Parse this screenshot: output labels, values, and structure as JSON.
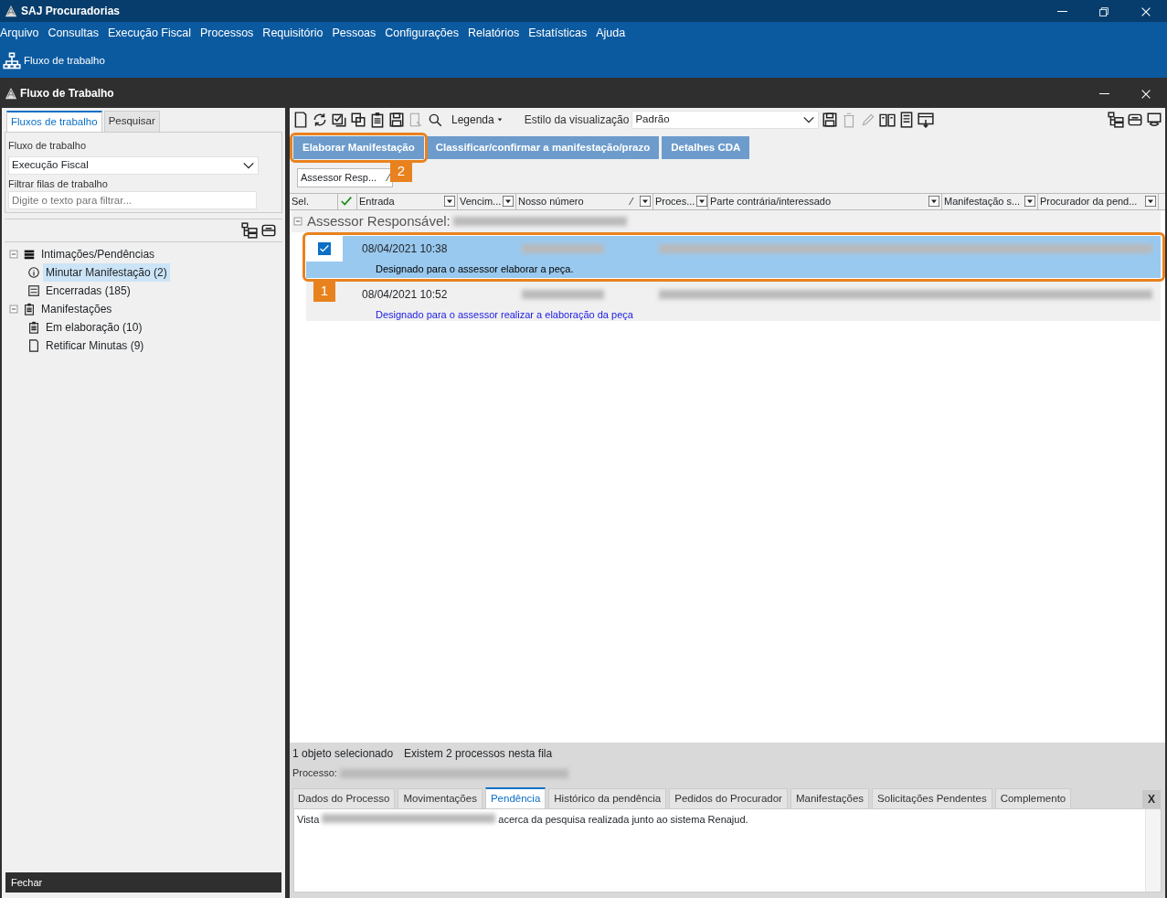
{
  "window": {
    "title": "SAJ Procuradorias"
  },
  "menu": [
    "Arquivo",
    "Consultas",
    "Execução Fiscal",
    "Processos",
    "Requisitório",
    "Pessoas",
    "Configurações",
    "Relatórios",
    "Estatísticas",
    "Ajuda"
  ],
  "ribbon": [
    {
      "label": "Fluxo de trabalho"
    }
  ],
  "inner_window": {
    "title": "Fluxo de Trabalho"
  },
  "sidebar": {
    "tabs": [
      {
        "label": "Fluxos de trabalho",
        "selected": true
      },
      {
        "label": "Pesquisar",
        "selected": false
      }
    ],
    "workflow_label": "Fluxo de trabalho",
    "workflow_value": "Execução Fiscal",
    "filter_label": "Filtrar filas de trabalho",
    "filter_placeholder": "Digite o texto para filtrar...",
    "tree": [
      {
        "label": "Intimações/Pendências",
        "kind": "list",
        "expanded": true,
        "selected": false,
        "children": [
          {
            "label": "Minutar Manifestação (2)",
            "kind": "info",
            "selected": true
          },
          {
            "label": "Encerradas (185)",
            "kind": "form",
            "selected": false
          }
        ]
      },
      {
        "label": "Manifestações",
        "kind": "clipboard",
        "expanded": true,
        "selected": false,
        "children": [
          {
            "label": "Em elaboração (10)",
            "kind": "clipboard",
            "selected": false
          },
          {
            "label": "Retificar Minutas (9)",
            "kind": "page",
            "selected": false
          }
        ]
      }
    ],
    "close_button": "Fechar"
  },
  "toolbar": {
    "legend_button": "Legenda",
    "style_label": "Estilo da visualização",
    "style_value": "Padrão"
  },
  "actions": [
    {
      "label": "Elaborar Manifestação",
      "callout": "2"
    },
    {
      "label": "Classificar/confirmar a manifestação/prazo"
    },
    {
      "label": "Detalhes CDA"
    }
  ],
  "group_chip": {
    "label": "Assessor Resp...",
    "sort_mark": "⁄"
  },
  "table": {
    "columns": [
      {
        "label": "Sel.",
        "kind": "plain"
      },
      {
        "kind": "check"
      },
      {
        "label": "Entrada",
        "kind": "filter"
      },
      {
        "label": "Vencim...",
        "kind": "filter"
      },
      {
        "label": "Nosso número",
        "kind": "filter",
        "sort_mark": "⁄"
      },
      {
        "label": "Proces...",
        "kind": "filter"
      },
      {
        "label": "Parte contrária/interessado",
        "kind": "filter"
      },
      {
        "label": "Manifestação s...",
        "kind": "filter"
      },
      {
        "label": "Procurador da pend...",
        "kind": "filter"
      }
    ],
    "group": {
      "label": "Assessor Responsável:",
      "expanded": true
    },
    "rows": [
      {
        "selected": true,
        "checked": true,
        "date": "08/04/2021 10:38",
        "description": "Designado para o assessor elaborar a peça.",
        "callout": "1"
      },
      {
        "selected": false,
        "date": "08/04/2021 10:52",
        "description": "Designado para o assessor realizar a elaboração da peça"
      }
    ]
  },
  "status": {
    "selected_count": "1 objeto selecionado",
    "queue_count": "Existem 2 processos nesta fila",
    "process_label": "Processo:"
  },
  "detail_tabs": [
    {
      "label": "Dados do Processo",
      "selected": false
    },
    {
      "label": "Movimentações",
      "selected": false
    },
    {
      "label": "Pendência",
      "selected": true
    },
    {
      "label": "Histórico da pendência",
      "selected": false
    },
    {
      "label": "Pedidos do Procurador",
      "selected": false
    },
    {
      "label": "Manifestações",
      "selected": false
    },
    {
      "label": "Solicitações Pendentes",
      "selected": false
    },
    {
      "label": "Complemento",
      "selected": false
    }
  ],
  "detail_close": "X",
  "detail_text": {
    "before": "Vista",
    "after": "acerca da pesquisa realizada junto ao sistema Renajud."
  }
}
